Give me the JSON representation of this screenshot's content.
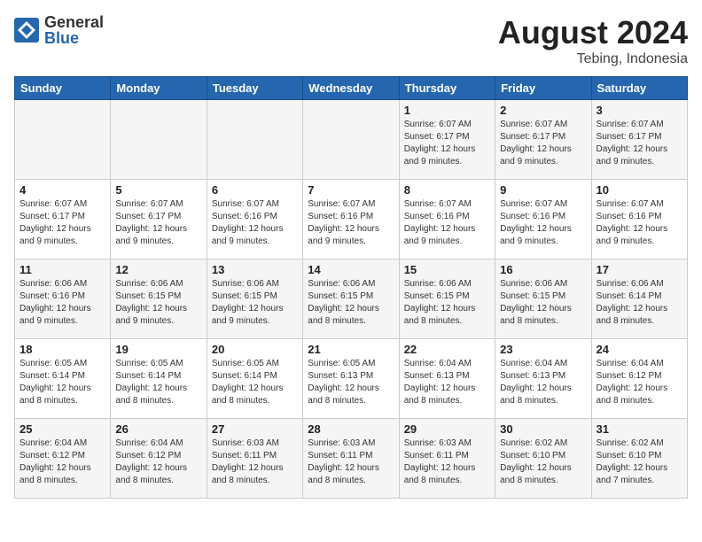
{
  "header": {
    "logo_general": "General",
    "logo_blue": "Blue",
    "main_title": "August 2024",
    "subtitle": "Tebing, Indonesia"
  },
  "columns": [
    "Sunday",
    "Monday",
    "Tuesday",
    "Wednesday",
    "Thursday",
    "Friday",
    "Saturday"
  ],
  "weeks": [
    [
      {
        "day": "",
        "sunrise": "",
        "sunset": "",
        "daylight": ""
      },
      {
        "day": "",
        "sunrise": "",
        "sunset": "",
        "daylight": ""
      },
      {
        "day": "",
        "sunrise": "",
        "sunset": "",
        "daylight": ""
      },
      {
        "day": "",
        "sunrise": "",
        "sunset": "",
        "daylight": ""
      },
      {
        "day": "1",
        "sunrise": "Sunrise: 6:07 AM",
        "sunset": "Sunset: 6:17 PM",
        "daylight": "Daylight: 12 hours and 9 minutes."
      },
      {
        "day": "2",
        "sunrise": "Sunrise: 6:07 AM",
        "sunset": "Sunset: 6:17 PM",
        "daylight": "Daylight: 12 hours and 9 minutes."
      },
      {
        "day": "3",
        "sunrise": "Sunrise: 6:07 AM",
        "sunset": "Sunset: 6:17 PM",
        "daylight": "Daylight: 12 hours and 9 minutes."
      }
    ],
    [
      {
        "day": "4",
        "sunrise": "Sunrise: 6:07 AM",
        "sunset": "Sunset: 6:17 PM",
        "daylight": "Daylight: 12 hours and 9 minutes."
      },
      {
        "day": "5",
        "sunrise": "Sunrise: 6:07 AM",
        "sunset": "Sunset: 6:17 PM",
        "daylight": "Daylight: 12 hours and 9 minutes."
      },
      {
        "day": "6",
        "sunrise": "Sunrise: 6:07 AM",
        "sunset": "Sunset: 6:16 PM",
        "daylight": "Daylight: 12 hours and 9 minutes."
      },
      {
        "day": "7",
        "sunrise": "Sunrise: 6:07 AM",
        "sunset": "Sunset: 6:16 PM",
        "daylight": "Daylight: 12 hours and 9 minutes."
      },
      {
        "day": "8",
        "sunrise": "Sunrise: 6:07 AM",
        "sunset": "Sunset: 6:16 PM",
        "daylight": "Daylight: 12 hours and 9 minutes."
      },
      {
        "day": "9",
        "sunrise": "Sunrise: 6:07 AM",
        "sunset": "Sunset: 6:16 PM",
        "daylight": "Daylight: 12 hours and 9 minutes."
      },
      {
        "day": "10",
        "sunrise": "Sunrise: 6:07 AM",
        "sunset": "Sunset: 6:16 PM",
        "daylight": "Daylight: 12 hours and 9 minutes."
      }
    ],
    [
      {
        "day": "11",
        "sunrise": "Sunrise: 6:06 AM",
        "sunset": "Sunset: 6:16 PM",
        "daylight": "Daylight: 12 hours and 9 minutes."
      },
      {
        "day": "12",
        "sunrise": "Sunrise: 6:06 AM",
        "sunset": "Sunset: 6:15 PM",
        "daylight": "Daylight: 12 hours and 9 minutes."
      },
      {
        "day": "13",
        "sunrise": "Sunrise: 6:06 AM",
        "sunset": "Sunset: 6:15 PM",
        "daylight": "Daylight: 12 hours and 9 minutes."
      },
      {
        "day": "14",
        "sunrise": "Sunrise: 6:06 AM",
        "sunset": "Sunset: 6:15 PM",
        "daylight": "Daylight: 12 hours and 8 minutes."
      },
      {
        "day": "15",
        "sunrise": "Sunrise: 6:06 AM",
        "sunset": "Sunset: 6:15 PM",
        "daylight": "Daylight: 12 hours and 8 minutes."
      },
      {
        "day": "16",
        "sunrise": "Sunrise: 6:06 AM",
        "sunset": "Sunset: 6:15 PM",
        "daylight": "Daylight: 12 hours and 8 minutes."
      },
      {
        "day": "17",
        "sunrise": "Sunrise: 6:06 AM",
        "sunset": "Sunset: 6:14 PM",
        "daylight": "Daylight: 12 hours and 8 minutes."
      }
    ],
    [
      {
        "day": "18",
        "sunrise": "Sunrise: 6:05 AM",
        "sunset": "Sunset: 6:14 PM",
        "daylight": "Daylight: 12 hours and 8 minutes."
      },
      {
        "day": "19",
        "sunrise": "Sunrise: 6:05 AM",
        "sunset": "Sunset: 6:14 PM",
        "daylight": "Daylight: 12 hours and 8 minutes."
      },
      {
        "day": "20",
        "sunrise": "Sunrise: 6:05 AM",
        "sunset": "Sunset: 6:14 PM",
        "daylight": "Daylight: 12 hours and 8 minutes."
      },
      {
        "day": "21",
        "sunrise": "Sunrise: 6:05 AM",
        "sunset": "Sunset: 6:13 PM",
        "daylight": "Daylight: 12 hours and 8 minutes."
      },
      {
        "day": "22",
        "sunrise": "Sunrise: 6:04 AM",
        "sunset": "Sunset: 6:13 PM",
        "daylight": "Daylight: 12 hours and 8 minutes."
      },
      {
        "day": "23",
        "sunrise": "Sunrise: 6:04 AM",
        "sunset": "Sunset: 6:13 PM",
        "daylight": "Daylight: 12 hours and 8 minutes."
      },
      {
        "day": "24",
        "sunrise": "Sunrise: 6:04 AM",
        "sunset": "Sunset: 6:12 PM",
        "daylight": "Daylight: 12 hours and 8 minutes."
      }
    ],
    [
      {
        "day": "25",
        "sunrise": "Sunrise: 6:04 AM",
        "sunset": "Sunset: 6:12 PM",
        "daylight": "Daylight: 12 hours and 8 minutes."
      },
      {
        "day": "26",
        "sunrise": "Sunrise: 6:04 AM",
        "sunset": "Sunset: 6:12 PM",
        "daylight": "Daylight: 12 hours and 8 minutes."
      },
      {
        "day": "27",
        "sunrise": "Sunrise: 6:03 AM",
        "sunset": "Sunset: 6:11 PM",
        "daylight": "Daylight: 12 hours and 8 minutes."
      },
      {
        "day": "28",
        "sunrise": "Sunrise: 6:03 AM",
        "sunset": "Sunset: 6:11 PM",
        "daylight": "Daylight: 12 hours and 8 minutes."
      },
      {
        "day": "29",
        "sunrise": "Sunrise: 6:03 AM",
        "sunset": "Sunset: 6:11 PM",
        "daylight": "Daylight: 12 hours and 8 minutes."
      },
      {
        "day": "30",
        "sunrise": "Sunrise: 6:02 AM",
        "sunset": "Sunset: 6:10 PM",
        "daylight": "Daylight: 12 hours and 8 minutes."
      },
      {
        "day": "31",
        "sunrise": "Sunrise: 6:02 AM",
        "sunset": "Sunset: 6:10 PM",
        "daylight": "Daylight: 12 hours and 7 minutes."
      }
    ]
  ]
}
